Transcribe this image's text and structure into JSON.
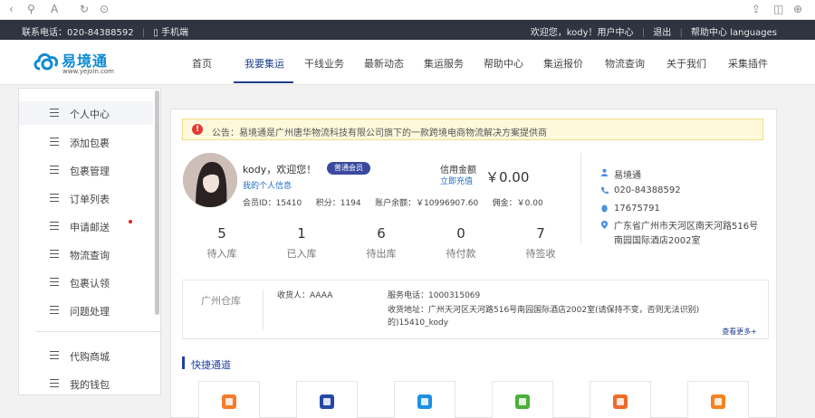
{
  "browser": {
    "icons": [
      "back-icon",
      "forward-icon",
      "link-icon",
      "text-size-icon",
      "refresh-icon",
      "compass-icon",
      "share-icon",
      "extension-icon",
      "add-icon"
    ]
  },
  "topbar": {
    "hotline": "联系电话：020-84388592",
    "mobile": "手机端",
    "welcome": "欢迎您，kody！用户中心",
    "logout": "退出",
    "help": "帮助中心",
    "languages": "languages"
  },
  "logo": {
    "name": "易境通",
    "url": "www.yejoin.com",
    "brand_color": "#0e8ad4"
  },
  "nav": {
    "items": [
      "首页",
      "我要集运",
      "干线业务",
      "最新动态",
      "集运服务",
      "帮助中心",
      "集运报价",
      "物流查询",
      "关于我们",
      "采集插件"
    ],
    "active_index": 1
  },
  "sidebar": {
    "items": [
      {
        "label": "个人中心",
        "active": true
      },
      {
        "label": "添加包裹"
      },
      {
        "label": "包裹管理"
      },
      {
        "label": "订单列表"
      },
      {
        "label": "申请邮送",
        "dot": true
      },
      {
        "label": "物流查询"
      },
      {
        "label": "包裹认领"
      },
      {
        "label": "问题处理"
      },
      {
        "label": "代购商城"
      },
      {
        "label": "我的钱包"
      }
    ]
  },
  "notice": {
    "text": "公告：易境通是广州唐华物流科技有限公司旗下的一款跨境电商物流解决方案提供商"
  },
  "user": {
    "name": "kody，欢迎您！",
    "vip": "普通会员",
    "sub": "我的个人信息",
    "member_id_label": "会员ID：",
    "member_id": "15410",
    "points_label": "积分：",
    "points": "1194",
    "balance_label": "账户余额：￥",
    "balance": "10996907.60",
    "commission_label": "佣金：￥",
    "commission": "0.00"
  },
  "credit": {
    "label": "信用金额",
    "sub": "立即充值",
    "value": "￥0.00"
  },
  "orders": [
    {
      "count": "5",
      "label": "待入库"
    },
    {
      "count": "1",
      "label": "已入库"
    },
    {
      "count": "6",
      "label": "待出库"
    },
    {
      "count": "0",
      "label": "待付款"
    },
    {
      "count": "7",
      "label": "待签收"
    }
  ],
  "contact": {
    "name": "易境通",
    "phone": "020-84388592",
    "qq": "17675791",
    "address": "广东省广州市天河区南天河路516号南园国际酒店2002室"
  },
  "warehouse": {
    "name": "广州仓库",
    "receiver": "收货人：AAAA",
    "service_phone": "服务电话：1000315069",
    "address_line1": "收货地址：广州天河区天河路516号南园国际酒店2002室(请保持不变，否则无法识别)",
    "address_line2": "的)15410_kody",
    "more": "查看更多+"
  },
  "quick_links": {
    "title": "快捷通道",
    "items": [
      {
        "icon": "package-icon",
        "color": "#f57c2a"
      },
      {
        "icon": "form-icon",
        "color": "#2449a5"
      },
      {
        "icon": "bike-icon",
        "color": "#1e90e6"
      },
      {
        "icon": "box-icon",
        "color": "#4caf3a"
      },
      {
        "icon": "list-icon",
        "color": "#f06a2a"
      },
      {
        "icon": "truck-icon",
        "color": "#f58220"
      }
    ]
  }
}
